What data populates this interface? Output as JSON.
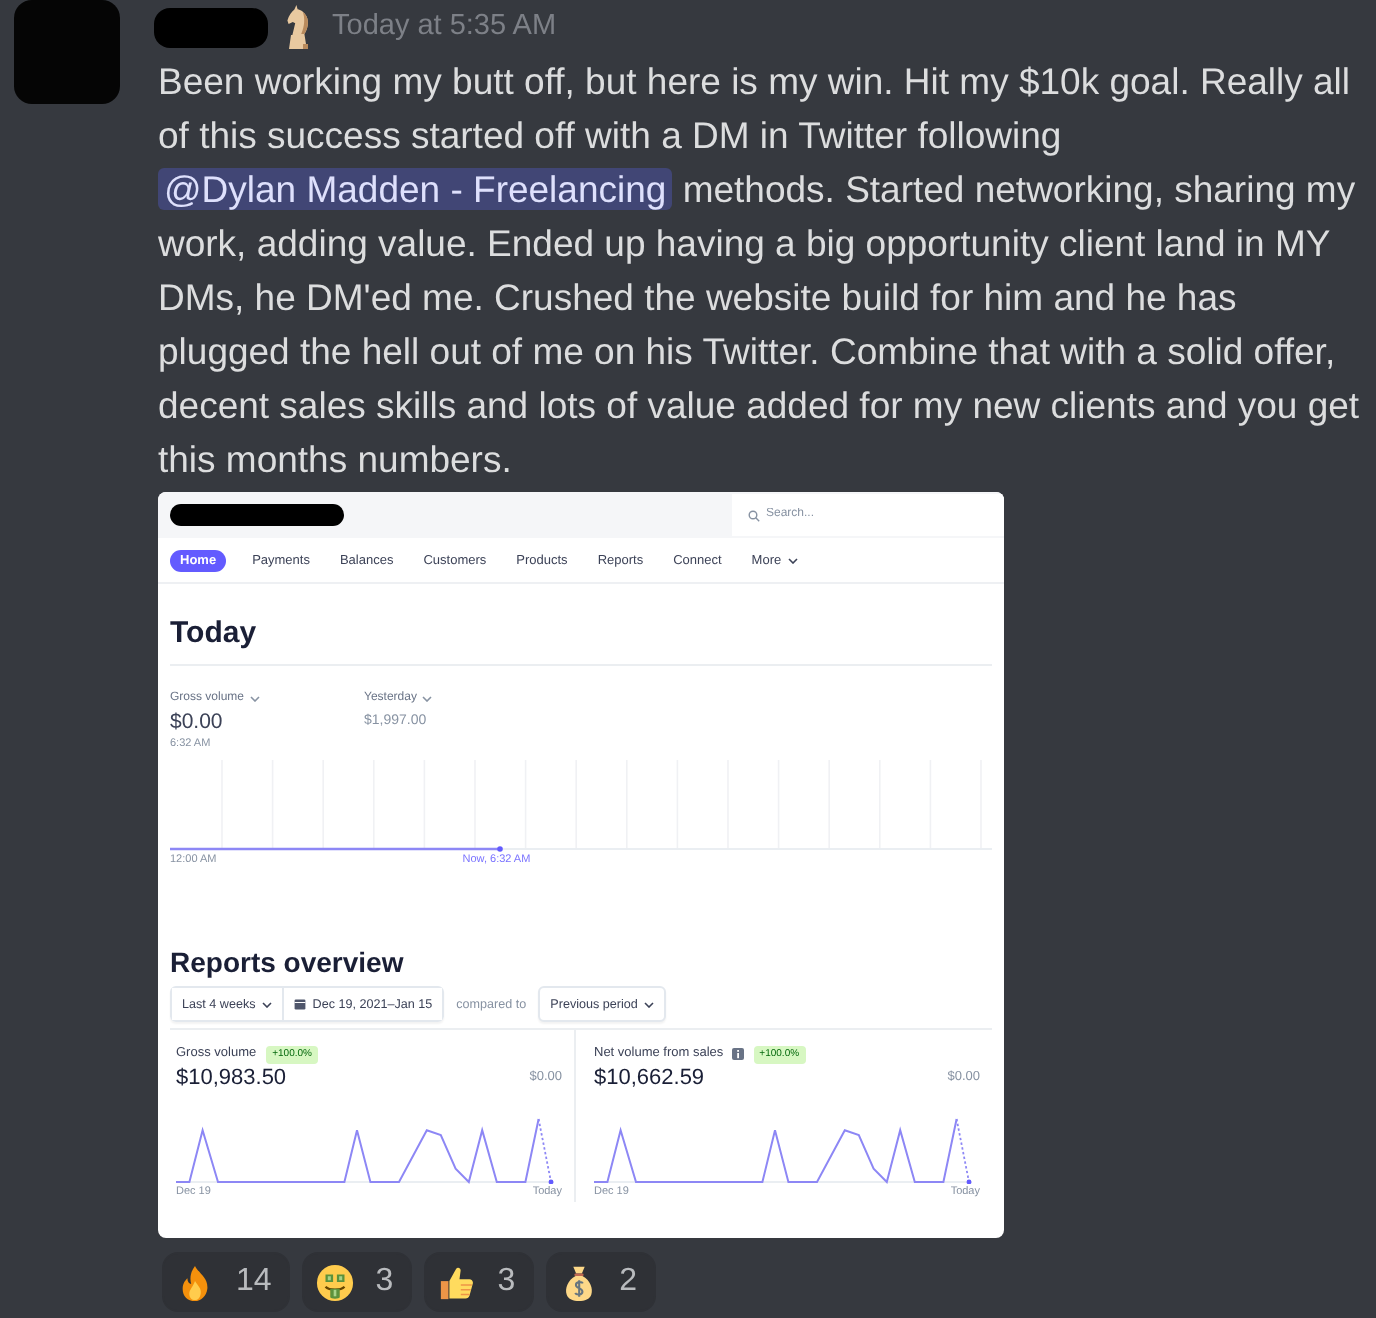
{
  "message": {
    "timestamp": "Today at 5:35 AM",
    "segments": [
      {
        "kind": "text",
        "text": "Been working my butt off, but here is my win. Hit my $10k goal. Really all of this success started off with a DM in Twitter following "
      },
      {
        "kind": "mention",
        "text": "@Dylan Madden - Freelancing"
      },
      {
        "kind": "text",
        "text": " methods. Started networking, sharing my work, adding value. Ended up having a big opportunity client land in MY DMs, he DM'ed me. Crushed the website build for him and he has plugged the hell out of me on his Twitter. Combine that with a solid offer, decent sales skills and lots of value added for my new clients and you get this months numbers."
      }
    ]
  },
  "embed": {
    "search": {
      "placeholder": "Search..."
    },
    "nav": [
      {
        "label": "Home",
        "kind": "link",
        "selected": true
      },
      {
        "label": "Payments",
        "kind": "link",
        "selected": false
      },
      {
        "label": "Balances",
        "kind": "link",
        "selected": false
      },
      {
        "label": "Customers",
        "kind": "link",
        "selected": false
      },
      {
        "label": "Products",
        "kind": "link",
        "selected": false
      },
      {
        "label": "Reports",
        "kind": "link",
        "selected": false
      },
      {
        "label": "Connect",
        "kind": "link",
        "selected": false
      },
      {
        "label": "More",
        "kind": "menu",
        "selected": false
      }
    ],
    "today": {
      "title": "Today",
      "metrics": [
        {
          "kind": "current",
          "label": "Gross volume",
          "value": "$0.00",
          "time": "6:32 AM"
        },
        {
          "kind": "comparison",
          "label": "Yesterday",
          "value": "$1,997.00"
        }
      ],
      "chart": {
        "start_label": "12:00 AM",
        "now_label": "Now, 6:32 AM"
      }
    },
    "reports": {
      "title": "Reports overview",
      "range_filters": [
        {
          "kind": "dropdown",
          "label": "Last 4 weeks"
        },
        {
          "kind": "date",
          "label": "Dec 19, 2021–Jan 15"
        }
      ],
      "compared_label": "compared to",
      "comparison": {
        "label": "Previous period"
      },
      "cards": [
        {
          "title": "Gross volume",
          "info": false,
          "badge": "+100.0%",
          "value": "$10,983.50",
          "previous": "$0.00",
          "start_label": "Dec 19",
          "end_label": "Today"
        },
        {
          "title": "Net volume from sales",
          "info": true,
          "badge": "+100.0%",
          "value": "$10,662.59",
          "previous": "$0.00",
          "start_label": "Dec 19",
          "end_label": "Today"
        }
      ]
    }
  },
  "reactions": [
    {
      "kind": "fire",
      "count": "14",
      "selected": false
    },
    {
      "kind": "moneyface",
      "count": "3",
      "selected": false
    },
    {
      "kind": "thumbsup",
      "count": "3",
      "selected": false
    },
    {
      "kind": "moneybag",
      "count": "2",
      "selected": false
    }
  ]
}
